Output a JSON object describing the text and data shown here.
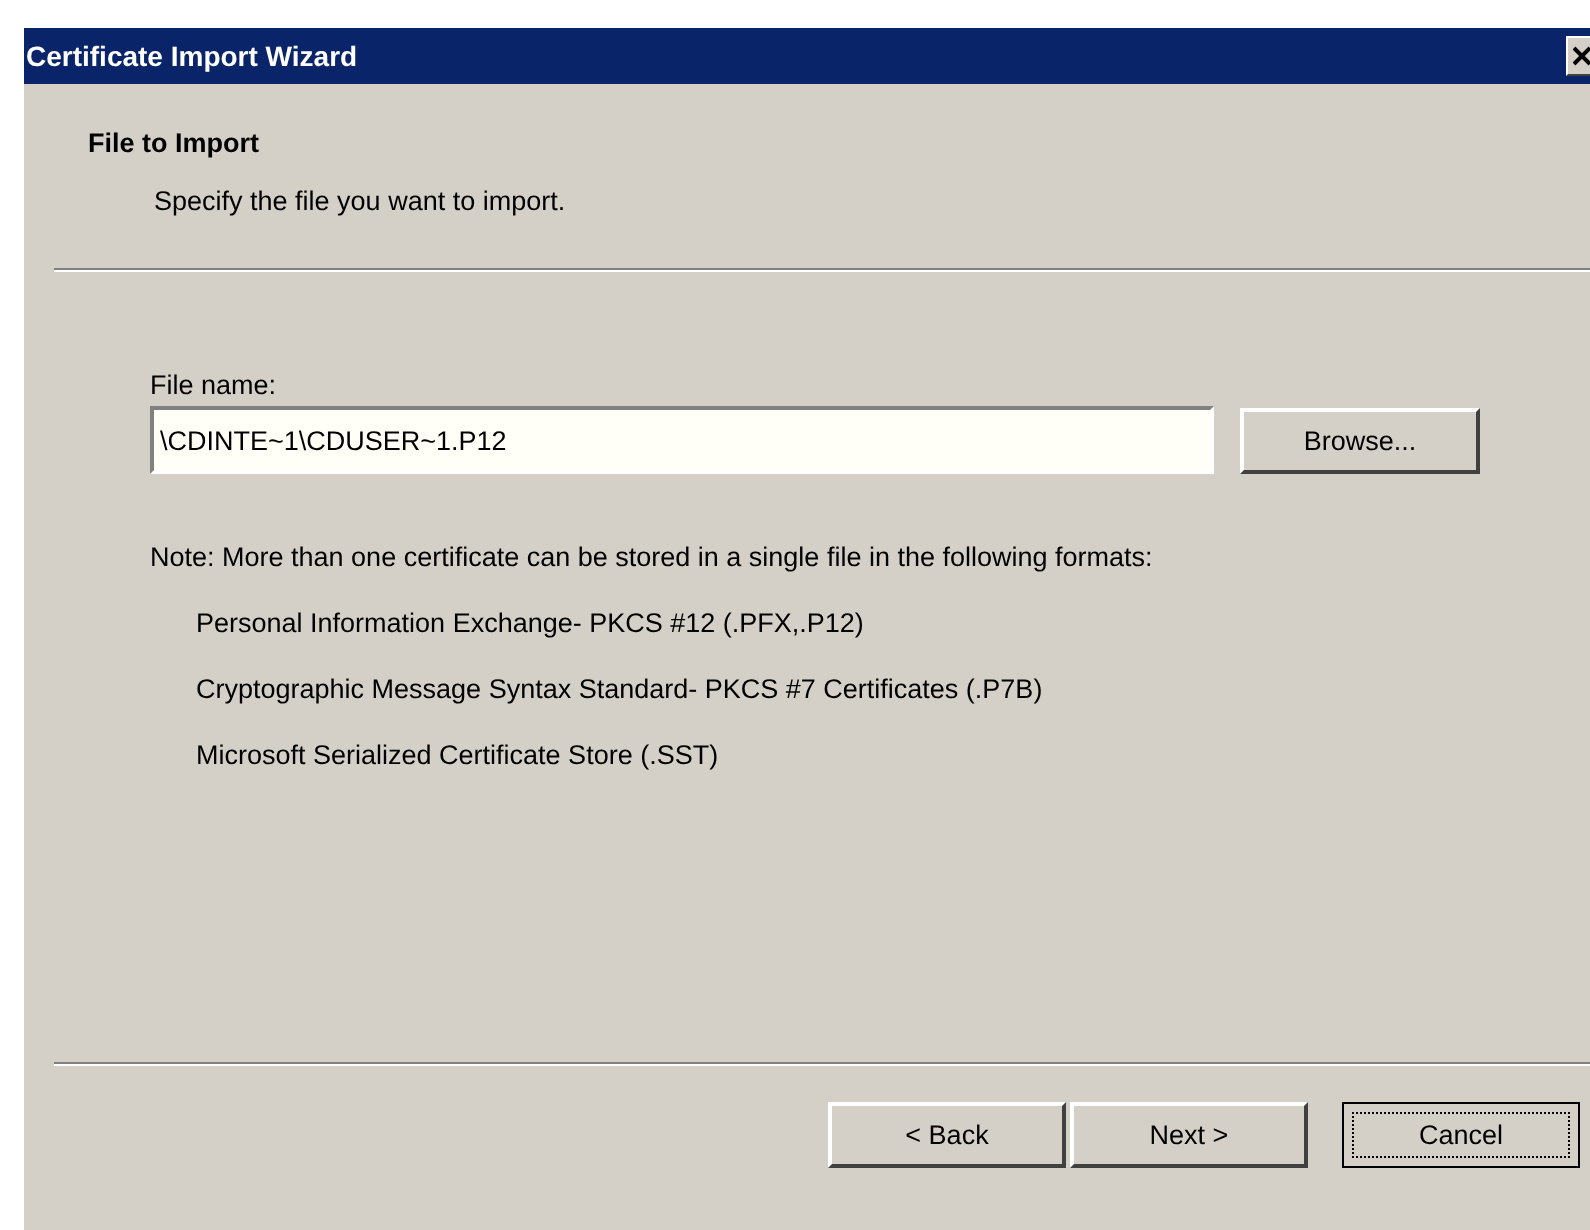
{
  "window": {
    "title": "Certificate Import Wizard"
  },
  "header": {
    "title": "File to Import",
    "subtitle": "Specify the file you want to import."
  },
  "file_field": {
    "label": "File name:",
    "value": "\\CDINTE~1\\CDUSER~1.P12",
    "button": "Browse..."
  },
  "note": "Note:  More than one certificate can be stored in a single file in the following formats:",
  "formats": [
    "Personal Information Exchange- PKCS #12 (.PFX,.P12)",
    "Cryptographic Message Syntax Standard- PKCS #7 Certificates (.P7B)",
    "Microsoft Serialized Certificate Store (.SST)"
  ],
  "buttons": [
    {
      "label": "< Back",
      "focused": false
    },
    {
      "label": "Next >",
      "focused": false
    },
    {
      "label": "Cancel",
      "focused": true
    }
  ]
}
